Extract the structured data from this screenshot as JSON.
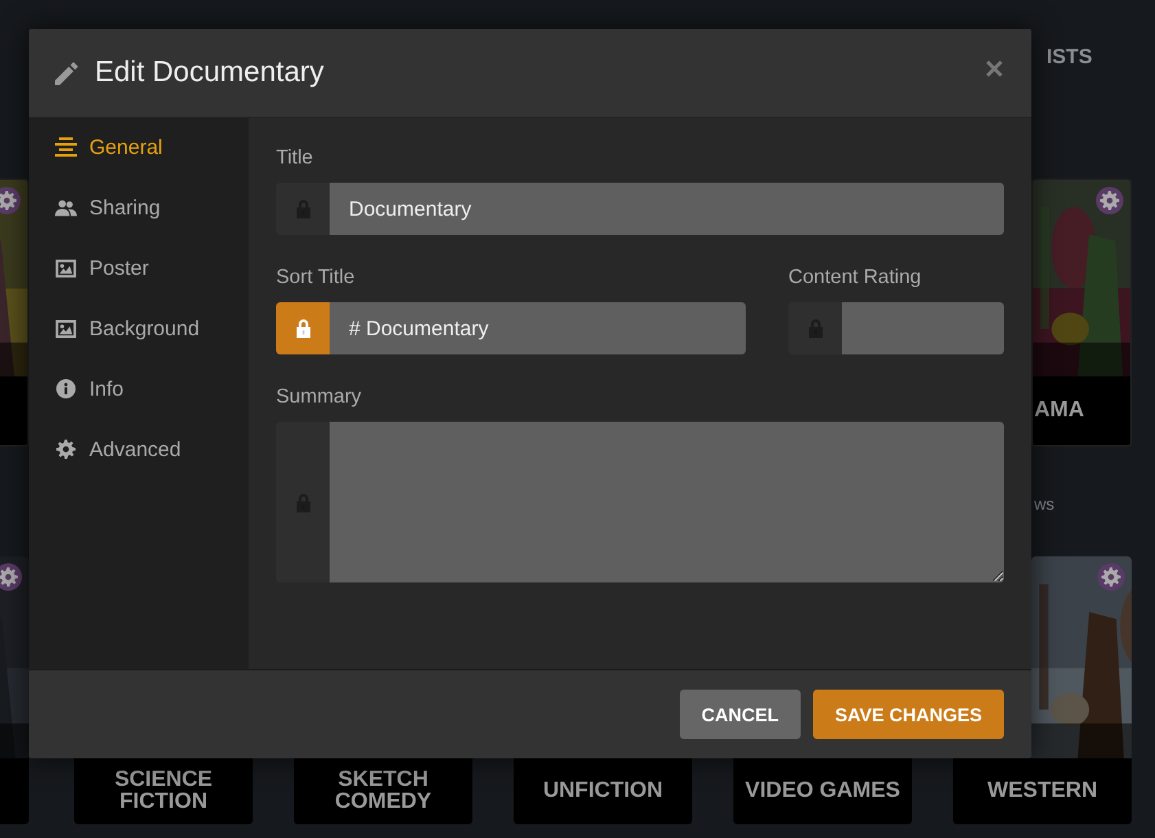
{
  "background": {
    "heading": "ISTS",
    "caption": "ws",
    "rows": [
      {
        "posters": [
          {
            "picture": true,
            "badge": true
          },
          {
            "picture": true,
            "badge": true,
            "label": "AMA"
          }
        ]
      },
      {
        "posters": [
          {
            "picture": true,
            "badge": true
          },
          {
            "label": "SCIENCE FICTION"
          },
          {
            "label": "SKETCH COMEDY"
          },
          {
            "label": "UNFICTION"
          },
          {
            "label": "VIDEO GAMES"
          },
          {
            "picture": true,
            "badge": true,
            "label": "WESTERN"
          }
        ]
      }
    ]
  },
  "dialog": {
    "title": "Edit Documentary",
    "sidebar": [
      {
        "label": "General",
        "selected": true
      },
      {
        "label": "Sharing",
        "selected": false
      },
      {
        "label": "Poster",
        "selected": false
      },
      {
        "label": "Background",
        "selected": false
      },
      {
        "label": "Info",
        "selected": false
      },
      {
        "label": "Advanced",
        "selected": false
      }
    ],
    "fields": [
      {
        "label": "Title",
        "kind": "text",
        "value": "Documentary",
        "locked": false
      },
      {
        "label": "Sort Title",
        "kind": "text",
        "value": "# Documentary",
        "locked": true
      },
      {
        "label": "Content Rating",
        "kind": "text",
        "locked": false
      },
      {
        "label": "Summary",
        "kind": "textarea",
        "locked": false
      }
    ],
    "buttons": [
      {
        "label": "CANCEL",
        "kind": "secondary"
      },
      {
        "label": "SAVE CHANGES",
        "kind": "primary"
      }
    ]
  }
}
